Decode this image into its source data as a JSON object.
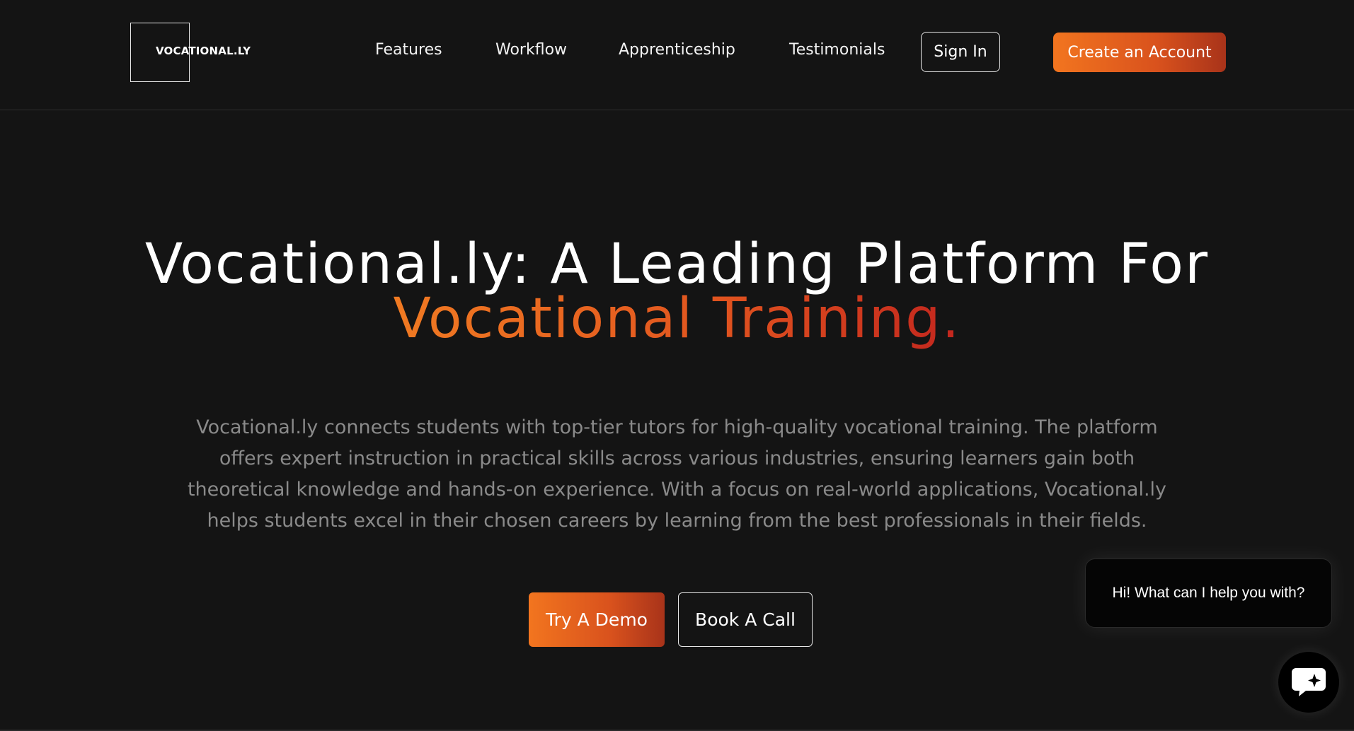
{
  "header": {
    "logo_text": "VOCATIONAL.LY",
    "nav": [
      "Features",
      "Workflow",
      "Apprenticeship",
      "Testimonials"
    ],
    "signin_label": "Sign In",
    "create_label": "Create an Account"
  },
  "hero": {
    "title_line1": "Vocational.ly: A Leading Platform For",
    "title_line2": "Vocational Training.",
    "description": "Vocational.ly connects students with top-tier tutors for high-quality vocational training. The platform offers expert instruction in practical skills across various industries, ensuring learners gain both theoretical knowledge and hands-on experience. With a focus on real-world applications, Vocational.ly helps students excel in their chosen careers by learning from the best professionals in their fields.",
    "demo_label": "Try A Demo",
    "call_label": "Book A Call"
  },
  "chat": {
    "greeting": "Hi! What can I help you with?",
    "launcher_icon": "chat-sparkle-icon"
  },
  "colors": {
    "background": "#141414",
    "accent_start": "#f2751f",
    "accent_end": "#a8331a",
    "muted_text": "#8a8a8a"
  }
}
